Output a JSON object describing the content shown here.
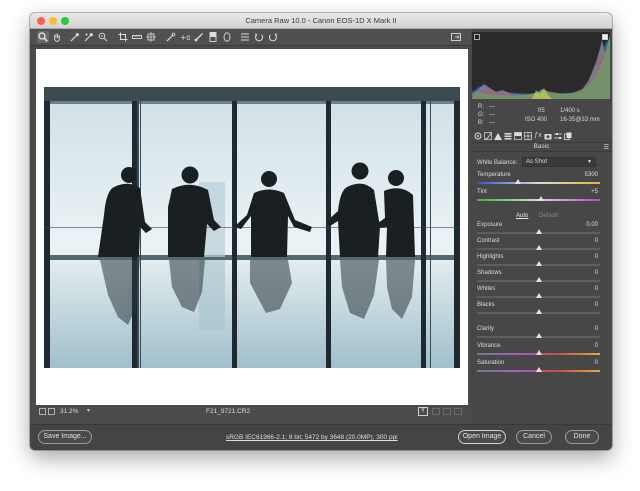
{
  "window": {
    "title": "Camera Raw 10.0  -  Canon EOS-1D X Mark II",
    "traffic_lights": {
      "close": "#fe5f57",
      "minimize": "#febc2e",
      "zoom": "#28c840"
    }
  },
  "toolbar": {
    "tools": [
      "zoom-tool",
      "hand-tool",
      "white-balance-tool",
      "color-sampler-tool",
      "targeted-adjustment-tool",
      "crop-tool",
      "straighten-tool",
      "transform-tool",
      "spot-removal-tool",
      "red-eye-removal-tool",
      "adjustment-brush",
      "graduated-filter",
      "radial-filter",
      "open-preferences",
      "rotate-left",
      "rotate-right",
      "fullscreen-toggle"
    ]
  },
  "image": {
    "subject": "silhouettes-of-business-people-by-window"
  },
  "status": {
    "zoom": "31.2%",
    "filename": "F21_9721.CR2",
    "view_mode": "Y"
  },
  "bottom": {
    "save_label": "Save Image...",
    "workflow_link": "sRGB IEC61966-2.1; 8 bit; 5472 by 3648 (20.0MP); 300 ppi",
    "open_label": "Open Image",
    "cancel_label": "Cancel",
    "done_label": "Done"
  },
  "panel": {
    "readout": {
      "r_label": "R:",
      "r_value": "---",
      "g_label": "G:",
      "g_value": "---",
      "b_label": "B:",
      "b_value": "---",
      "aperture": "f/5",
      "shutter": "1/400 s",
      "iso": "ISO 400",
      "lens": "16-35@33 mm"
    },
    "section_title": "Basic",
    "white_balance": {
      "label": "White Balance:",
      "value": "As Shot"
    },
    "auto_label": "Auto",
    "default_label": "Default",
    "sliders": [
      {
        "label": "Temperature",
        "value": "5300",
        "pos": 0.33
      },
      {
        "label": "Tint",
        "value": "+5",
        "pos": 0.52
      },
      {
        "label": "Exposure",
        "value": "0.00",
        "pos": 0.5
      },
      {
        "label": "Contrast",
        "value": "0",
        "pos": 0.5
      },
      {
        "label": "Highlights",
        "value": "0",
        "pos": 0.5
      },
      {
        "label": "Shadows",
        "value": "0",
        "pos": 0.5
      },
      {
        "label": "Whites",
        "value": "0",
        "pos": 0.5
      },
      {
        "label": "Blacks",
        "value": "0",
        "pos": 0.5
      },
      {
        "label": "Clarity",
        "value": "0",
        "pos": 0.5
      },
      {
        "label": "Vibrance",
        "value": "0",
        "pos": 0.5
      },
      {
        "label": "Saturation",
        "value": "0",
        "pos": 0.5
      }
    ]
  }
}
